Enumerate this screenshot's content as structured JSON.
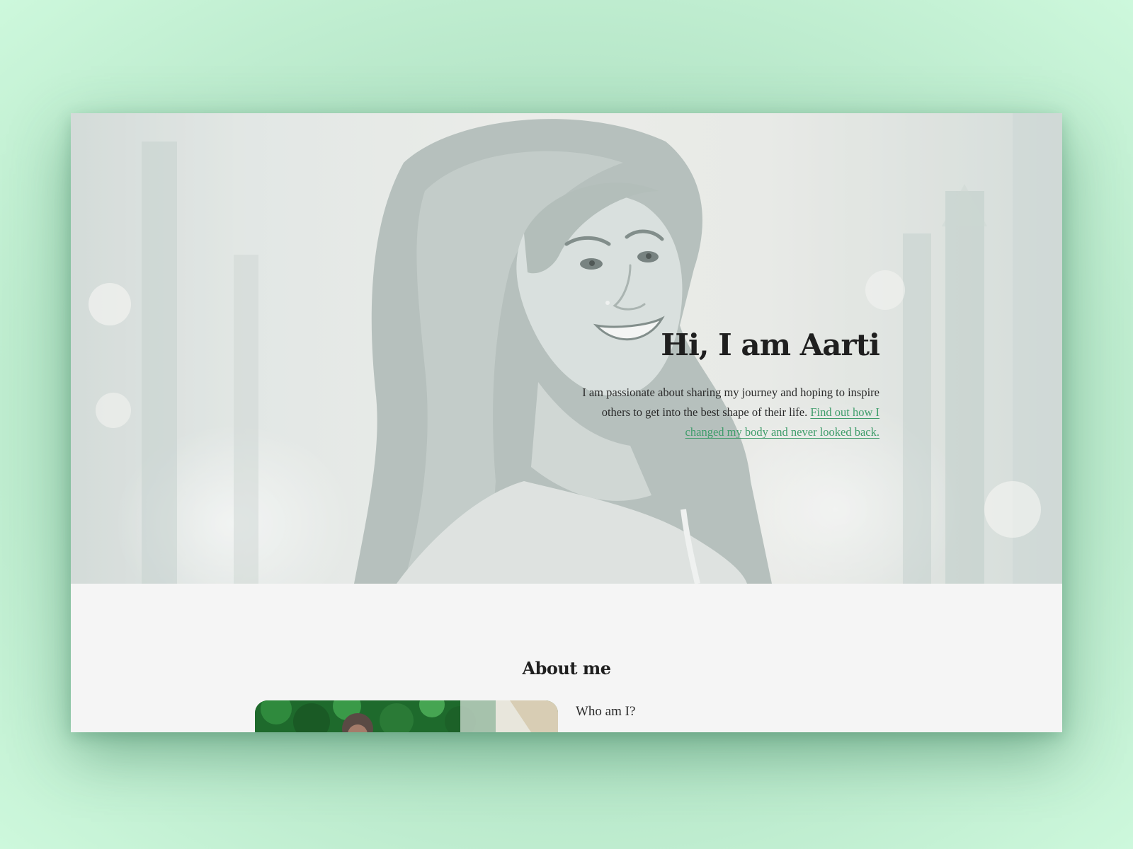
{
  "colors": {
    "page_background": "#b6e6c8",
    "section_background": "#f5f5f5",
    "link": "#3e9c6a",
    "heading": "#1f1f1f"
  },
  "hero": {
    "title": "Hi, I am Aarti",
    "description": "I am passionate about sharing my journey and hoping to inspire others to get into the best shape of their life.",
    "link_text": "Find out how I changed my body and never looked back.",
    "image_alt": "Portrait of Aarti smiling over her shoulder"
  },
  "about": {
    "title": "About me",
    "question": "Who am I?",
    "image_alt": "Aarti outdoors among greenery"
  }
}
